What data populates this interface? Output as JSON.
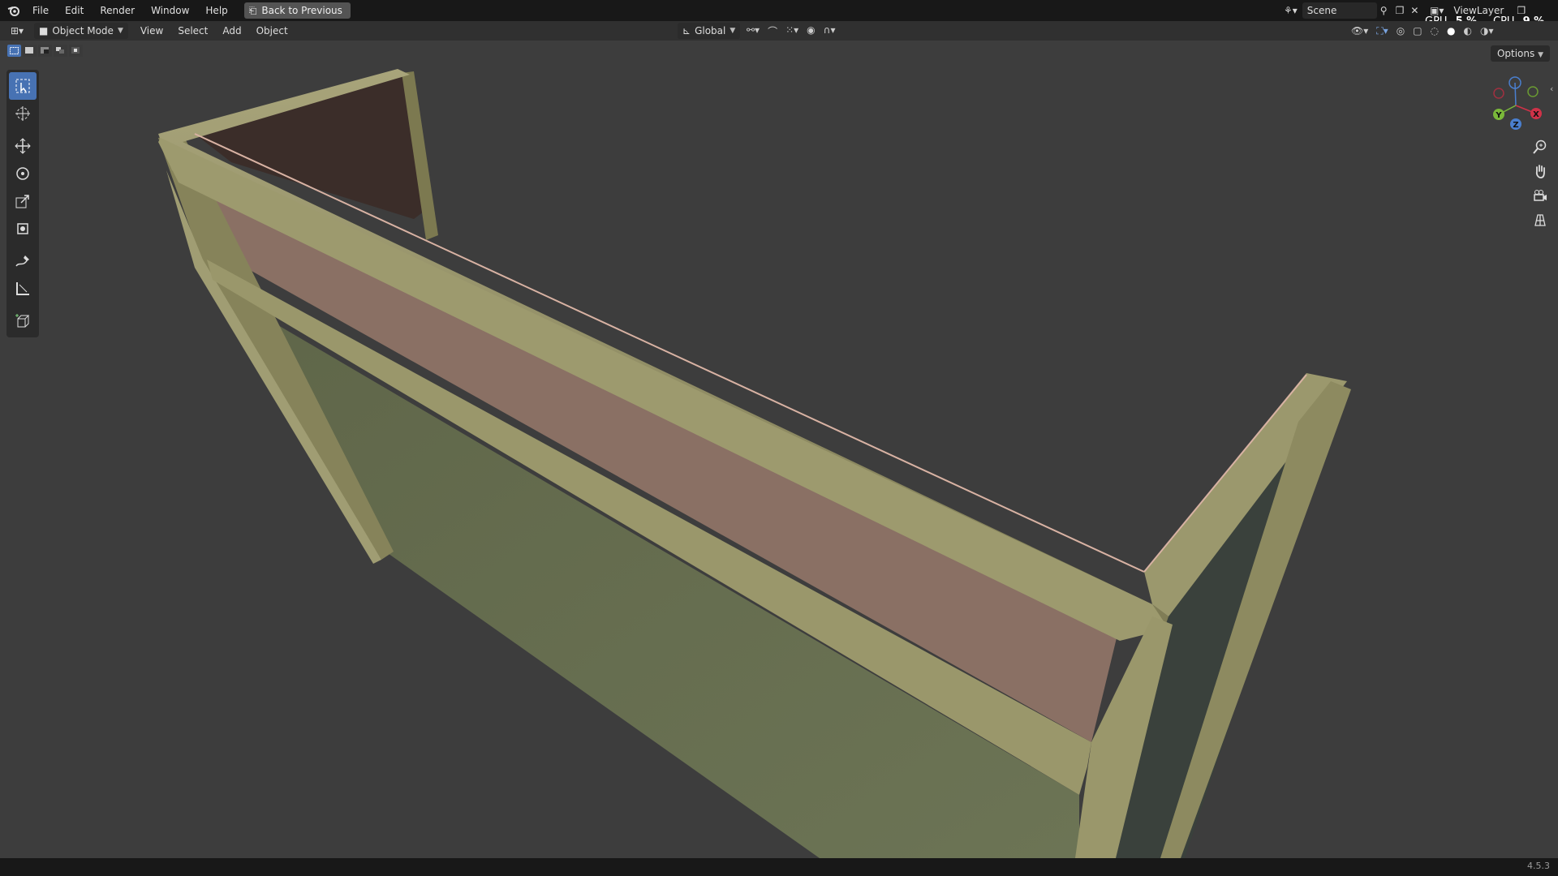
{
  "topbar": {
    "menus": [
      "File",
      "Edit",
      "Render",
      "Window",
      "Help"
    ],
    "back_button": "Back to Previous",
    "scene_name": "Scene",
    "view_layer": "ViewLayer",
    "gpu_label": "GPU",
    "gpu_value": "5 %",
    "cpu_label": "CPU",
    "cpu_value": "9 %"
  },
  "viewport_header": {
    "mode": "Object Mode",
    "menus": [
      "View",
      "Select",
      "Add",
      "Object"
    ],
    "transform_orientation": "Global",
    "options_label": "Options"
  },
  "toolbar": {
    "tools": [
      "select-box",
      "cursor",
      "move",
      "rotate",
      "scale",
      "transform",
      "annotate",
      "measure",
      "add-cube"
    ],
    "active_tool": "select-box"
  },
  "gizmo": {
    "x_label": "X",
    "y_label": "Y",
    "z_label": "Z"
  },
  "colors": {
    "frame": "#8e8b62",
    "pink_panel": "#8a7064",
    "green_panel": "#6a7152",
    "back_panel": "#3b2d29",
    "accent": "#4772b3"
  },
  "statusbar": {
    "version": "4.5.3"
  }
}
